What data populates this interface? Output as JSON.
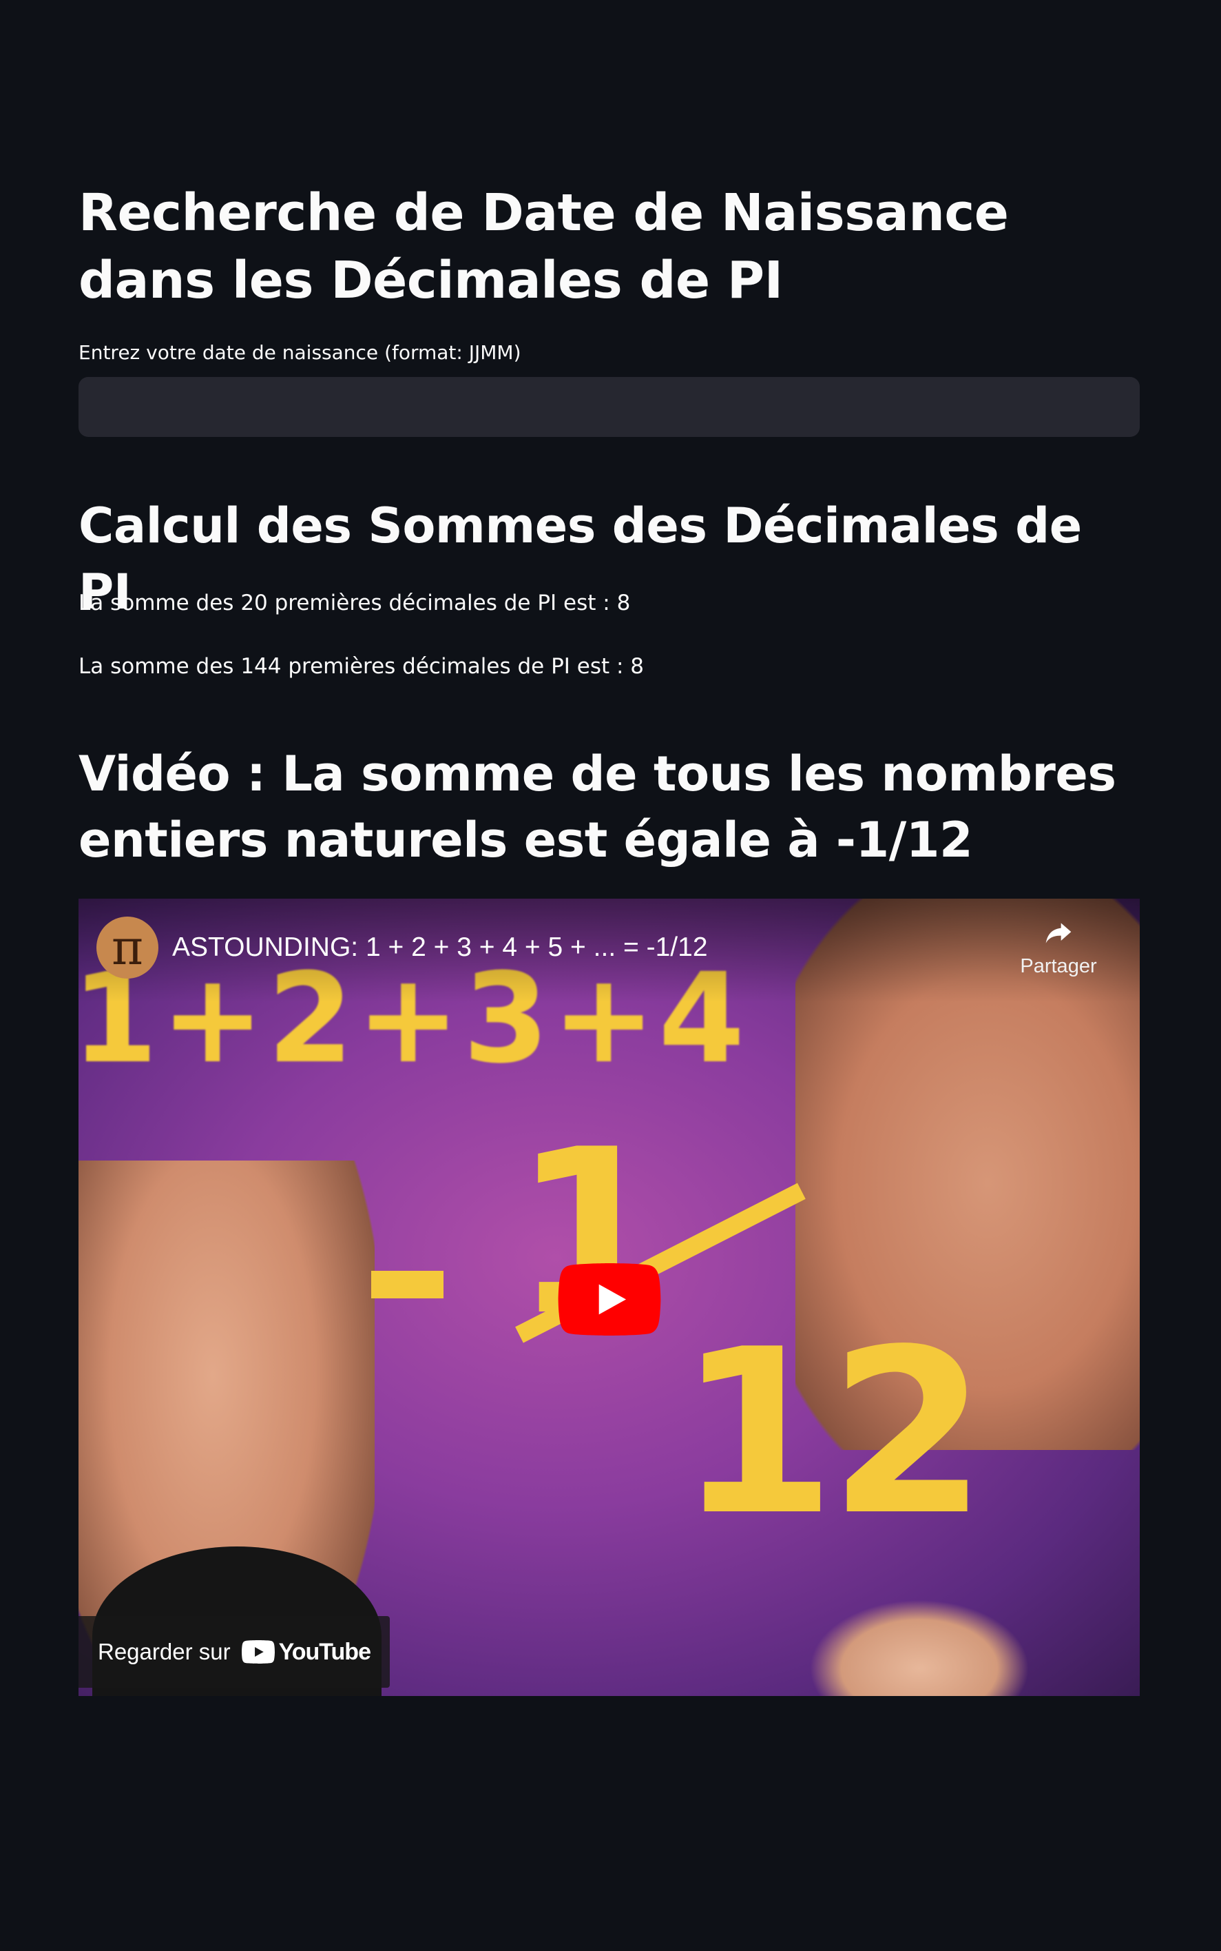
{
  "header": {
    "title": "Recherche de Date de Naissance dans les Décimales de PI"
  },
  "birthdate": {
    "label": "Entrez votre date de naissance (format: JJMM)",
    "value": "",
    "placeholder": ""
  },
  "sums": {
    "title": "Calcul des Sommes des Décimales de PI",
    "line_20": "La somme des 20 premières décimales de PI est : 8",
    "line_144": "La somme des 144 premières décimales de PI est : 8"
  },
  "video_section": {
    "title": "Vidéo : La somme de tous les nombres entiers naturels est égale à -1/12"
  },
  "video": {
    "title": "ASTOUNDING: 1 + 2 + 3 + 4 + 5 + ... = -1/12",
    "channel_avatar_glyph": "π",
    "share_label": "Partager",
    "watch_on_label": "Regarder sur",
    "youtube_wordmark": "YouTube",
    "thumbnail": {
      "numbers_text": "1+2+3+4",
      "minus": "-",
      "numerator": "1",
      "denominator": "12"
    },
    "icons": {
      "share": "share-arrow-icon",
      "play": "youtube-play-icon",
      "logo": "youtube-logo-icon"
    },
    "colors": {
      "thumbnail_yellow": "#f5c93b",
      "play_red": "#ff0000",
      "background_purple": "#8a3c9e"
    }
  },
  "theme": {
    "background": "#0e1117",
    "input_background": "#262730",
    "text": "#fafafa"
  }
}
